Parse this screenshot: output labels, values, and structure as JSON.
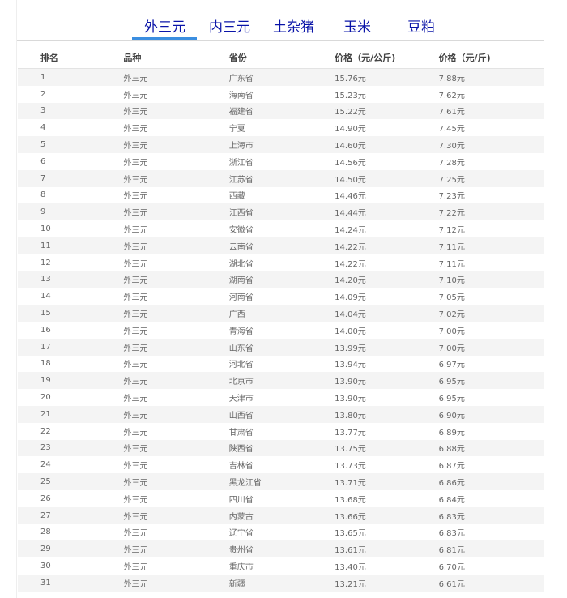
{
  "tabs": [
    {
      "label": "外三元",
      "active": true
    },
    {
      "label": "内三元",
      "active": false
    },
    {
      "label": "土杂猪",
      "active": false
    },
    {
      "label": "玉米",
      "active": false
    },
    {
      "label": "豆粕",
      "active": false
    }
  ],
  "table": {
    "headers": [
      "排名",
      "品种",
      "省份",
      "价格（元/公斤)",
      "价格（元/斤)"
    ],
    "rows": [
      [
        "1",
        "外三元",
        "广东省",
        "15.76元",
        "7.88元"
      ],
      [
        "2",
        "外三元",
        "海南省",
        "15.23元",
        "7.62元"
      ],
      [
        "3",
        "外三元",
        "福建省",
        "15.22元",
        "7.61元"
      ],
      [
        "4",
        "外三元",
        "宁夏",
        "14.90元",
        "7.45元"
      ],
      [
        "5",
        "外三元",
        "上海市",
        "14.60元",
        "7.30元"
      ],
      [
        "6",
        "外三元",
        "浙江省",
        "14.56元",
        "7.28元"
      ],
      [
        "7",
        "外三元",
        "江苏省",
        "14.50元",
        "7.25元"
      ],
      [
        "8",
        "外三元",
        "西藏",
        "14.46元",
        "7.23元"
      ],
      [
        "9",
        "外三元",
        "江西省",
        "14.44元",
        "7.22元"
      ],
      [
        "10",
        "外三元",
        "安徽省",
        "14.24元",
        "7.12元"
      ],
      [
        "11",
        "外三元",
        "云南省",
        "14.22元",
        "7.11元"
      ],
      [
        "12",
        "外三元",
        "湖北省",
        "14.22元",
        "7.11元"
      ],
      [
        "13",
        "外三元",
        "湖南省",
        "14.20元",
        "7.10元"
      ],
      [
        "14",
        "外三元",
        "河南省",
        "14.09元",
        "7.05元"
      ],
      [
        "15",
        "外三元",
        "广西",
        "14.04元",
        "7.02元"
      ],
      [
        "16",
        "外三元",
        "青海省",
        "14.00元",
        "7.00元"
      ],
      [
        "17",
        "外三元",
        "山东省",
        "13.99元",
        "7.00元"
      ],
      [
        "18",
        "外三元",
        "河北省",
        "13.94元",
        "6.97元"
      ],
      [
        "19",
        "外三元",
        "北京市",
        "13.90元",
        "6.95元"
      ],
      [
        "20",
        "外三元",
        "天津市",
        "13.90元",
        "6.95元"
      ],
      [
        "21",
        "外三元",
        "山西省",
        "13.80元",
        "6.90元"
      ],
      [
        "22",
        "外三元",
        "甘肃省",
        "13.77元",
        "6.89元"
      ],
      [
        "23",
        "外三元",
        "陕西省",
        "13.75元",
        "6.88元"
      ],
      [
        "24",
        "外三元",
        "吉林省",
        "13.73元",
        "6.87元"
      ],
      [
        "25",
        "外三元",
        "黑龙江省",
        "13.71元",
        "6.86元"
      ],
      [
        "26",
        "外三元",
        "四川省",
        "13.68元",
        "6.84元"
      ],
      [
        "27",
        "外三元",
        "内蒙古",
        "13.66元",
        "6.83元"
      ],
      [
        "28",
        "外三元",
        "辽宁省",
        "13.65元",
        "6.83元"
      ],
      [
        "29",
        "外三元",
        "贵州省",
        "13.61元",
        "6.81元"
      ],
      [
        "30",
        "外三元",
        "重庆市",
        "13.40元",
        "6.70元"
      ],
      [
        "31",
        "外三元",
        "新疆",
        "13.21元",
        "6.61元"
      ]
    ]
  },
  "colors": {
    "tab_text": "#0a14a8",
    "tab_underline": "#3b8ee0",
    "row_stripe": "#f4f4f4"
  }
}
